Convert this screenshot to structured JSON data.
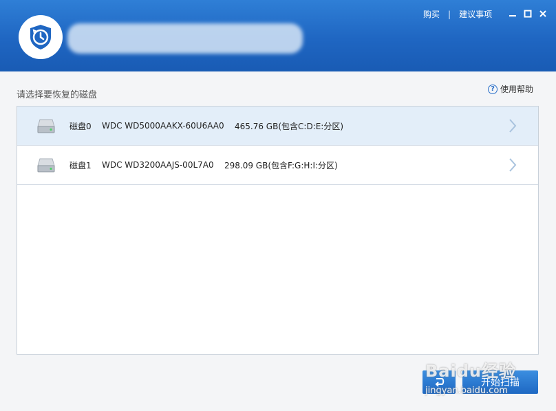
{
  "header": {
    "top_links": [
      "购买",
      "建议事项"
    ],
    "separator": "|",
    "window_controls": [
      "minimize-icon",
      "maximize-icon",
      "close-icon"
    ]
  },
  "main": {
    "prompt": "请选择要恢复的磁盘",
    "help_label": "使用帮助",
    "disks": [
      {
        "name": "磁盘0",
        "model": "WDC WD5000AAKX-60U6AA0",
        "size": "465.76 GB(包含C:D:E:分区)",
        "selected": true
      },
      {
        "name": "磁盘1",
        "model": "WDC WD3200AAJS-00L7A0",
        "size": "298.09 GB(包含F:G:H:I:分区)",
        "selected": false
      }
    ]
  },
  "footer": {
    "scan_label": "开始扫描",
    "back_icon": "back-arrow-icon"
  },
  "watermark": {
    "text": "Baidu经验",
    "url": "jingyan.baidu.com"
  },
  "colors": {
    "header_blue": "#1f66c2",
    "selected_row": "#e3eef9",
    "button_blue": "#1e68c3"
  }
}
